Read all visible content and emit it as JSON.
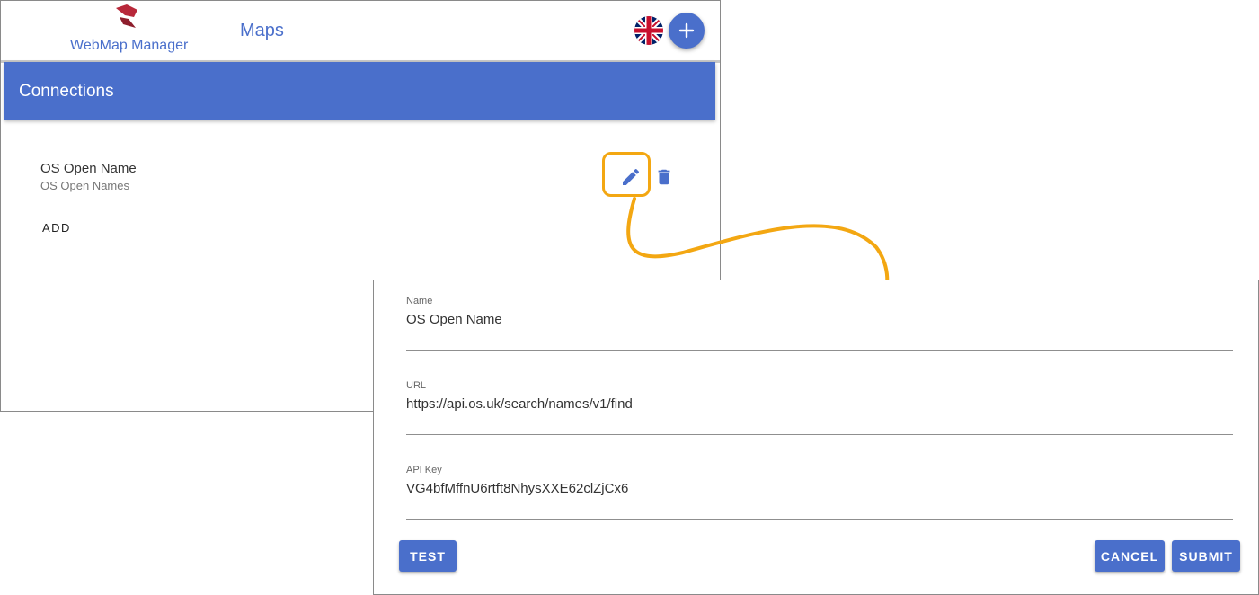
{
  "header": {
    "brand": "WebMap Manager",
    "nav_maps": "Maps",
    "language_icon": "uk-flag-icon",
    "add_icon": "plus-icon",
    "logo_color": "#b8283a"
  },
  "section": {
    "title": "Connections"
  },
  "connections": [
    {
      "name": "OS Open Name",
      "subtitle": "OS Open Names",
      "edit_icon": "pencil-icon",
      "delete_icon": "trash-icon"
    }
  ],
  "add_label": "ADD",
  "dialog": {
    "fields": {
      "name": {
        "label": "Name",
        "value": "OS Open Name"
      },
      "url": {
        "label": "URL",
        "value": "https://api.os.uk/search/names/v1/find"
      },
      "api_key": {
        "label": "API Key",
        "value": "VG4bfMffnU6rtft8NhysXXE62clZjCx6"
      }
    },
    "test_label": "TEST",
    "cancel_label": "CANCEL",
    "submit_label": "SUBMIT"
  },
  "colors": {
    "primary": "#4a6fcb",
    "highlight": "#f3a712"
  }
}
